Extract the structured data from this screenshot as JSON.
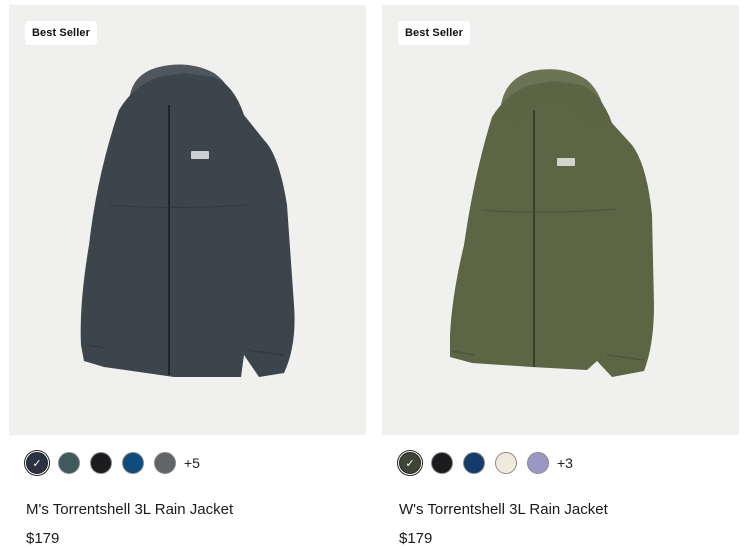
{
  "products": [
    {
      "badge": "Best Seller",
      "name": "M's Torrentshell 3L Rain Jacket",
      "price": "$179",
      "more_colors": "+5",
      "jacket_color": "#3d454c",
      "swatches": [
        {
          "color": "#2b3242",
          "selected": true
        },
        {
          "color": "#3f5a5c",
          "selected": false
        },
        {
          "color": "#1c1c1e",
          "selected": false
        },
        {
          "color": "#0f4c7e",
          "selected": false
        },
        {
          "color": "#626466",
          "selected": false
        }
      ]
    },
    {
      "badge": "Best Seller",
      "name": "W's Torrentshell 3L Rain Jacket",
      "price": "$179",
      "more_colors": "+3",
      "jacket_color": "#5c6544",
      "swatches": [
        {
          "color": "#3e4436",
          "selected": true
        },
        {
          "color": "#1c1c1e",
          "selected": false
        },
        {
          "color": "#123d6b",
          "selected": false
        },
        {
          "color": "#efeadb",
          "selected": false
        },
        {
          "color": "#9b97c4",
          "selected": false
        }
      ]
    }
  ],
  "icons": {
    "check": "check-icon",
    "logo_patch": "brand-patch-icon"
  }
}
